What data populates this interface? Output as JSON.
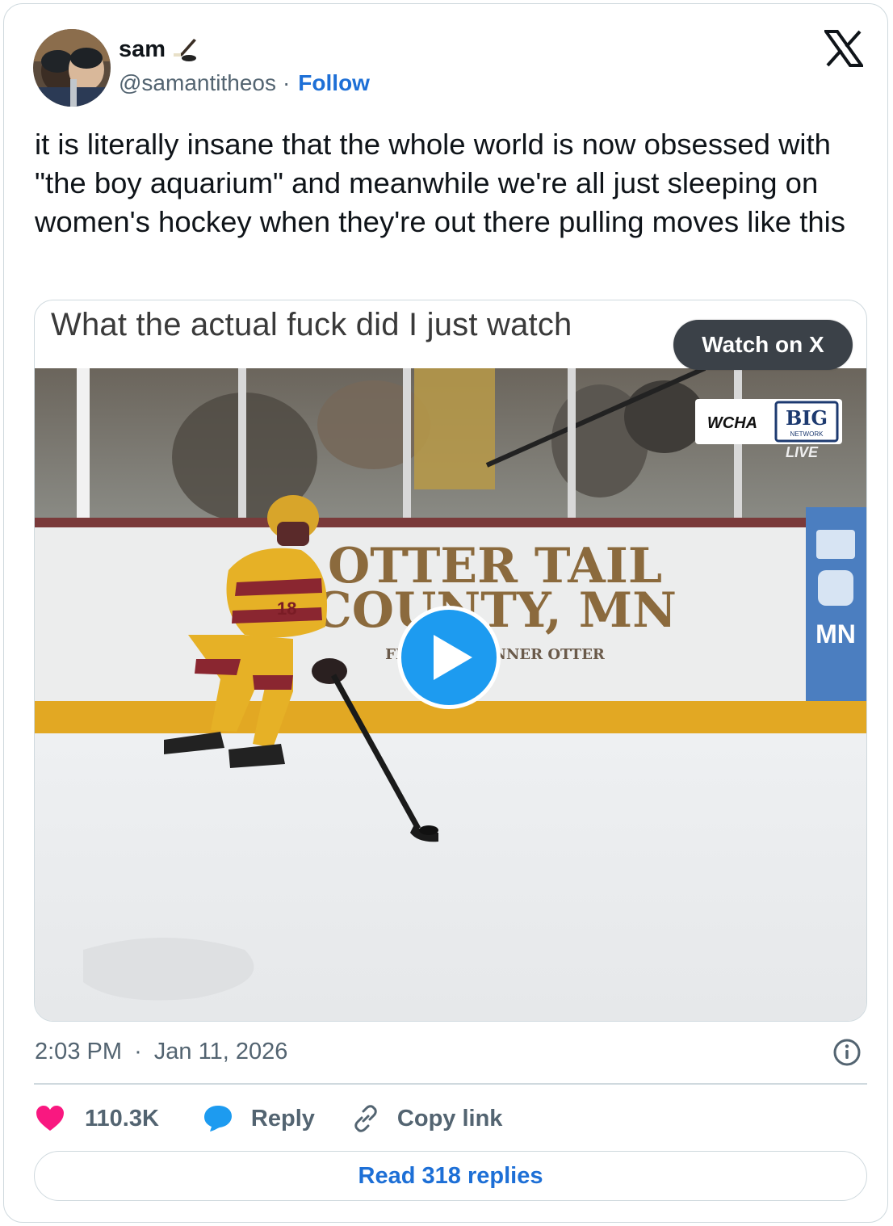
{
  "author": {
    "display_name": "sam",
    "name_emoji": "hockey-stick-icon",
    "handle": "@samantitheos",
    "separator": "·",
    "follow_label": "Follow"
  },
  "tweet": {
    "text": "it is literally insane that the whole world is now obsessed with \"the boy aquarium\" and meanwhile we're all just sleeping on women's hockey when they're out there pulling moves like this"
  },
  "media": {
    "caption": "What the actual fuck did I just watch",
    "watch_label": "Watch on X",
    "scene": {
      "board_ad_line1": "OTTER TAIL",
      "board_ad_line2": "COUNTY, MN",
      "board_ad_line3": "FIND YOUR INNER OTTER",
      "broadcast_logo_left": "WCHA",
      "broadcast_logo_right": "BIG",
      "broadcast_logo_sub": "NETWORK",
      "broadcast_live": "LIVE",
      "side_ad_text": "MN",
      "jersey_number": "18"
    }
  },
  "meta": {
    "time": "2:03 PM",
    "separator": "·",
    "date": "Jan 11, 2026"
  },
  "actions": {
    "likes": "110.3K",
    "reply_label": "Reply",
    "copy_label": "Copy link"
  },
  "read_replies_label": "Read 318 replies",
  "colors": {
    "accent": "#1d6fd6",
    "like": "#f91880",
    "reply": "#1d9bf0",
    "muted": "#536471",
    "border": "#cfd9de"
  }
}
